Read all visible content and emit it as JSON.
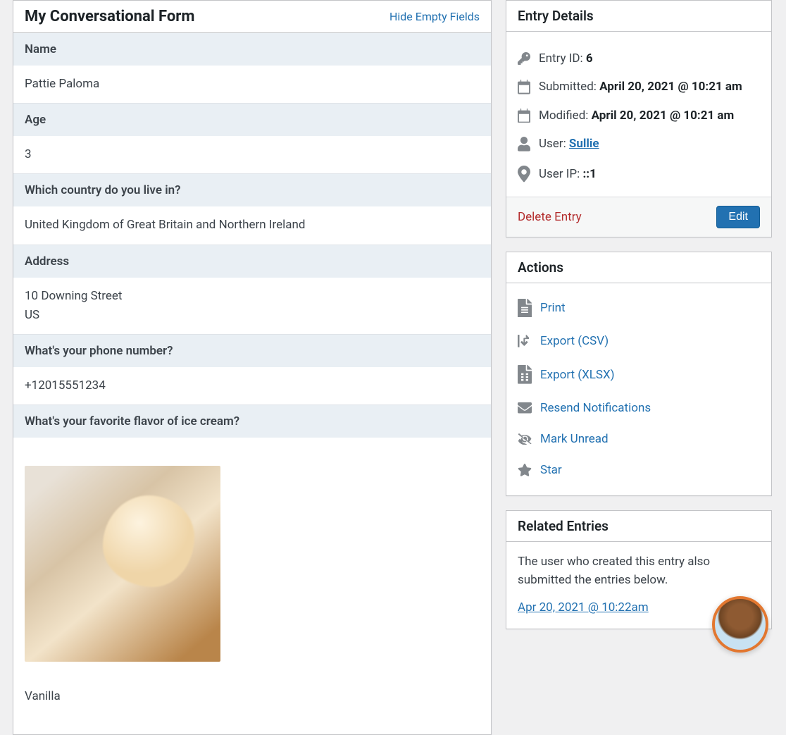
{
  "main": {
    "form_title": "My Conversational Form",
    "hide_empty_label": "Hide Empty Fields",
    "fields": [
      {
        "label": "Name",
        "value": "Pattie Paloma"
      },
      {
        "label": "Age",
        "value": "3"
      },
      {
        "label": "Which country do you live in?",
        "value": "United Kingdom of Great Britain and Northern Ireland"
      },
      {
        "label": "Address",
        "value": "10 Downing Street\nUS"
      },
      {
        "label": "What's your phone number?",
        "value": "+12015551234"
      },
      {
        "label": "What's your favorite flavor of ice cream?",
        "value": "Vanilla",
        "has_image": true
      }
    ]
  },
  "sidebar": {
    "details": {
      "title": "Entry Details",
      "entry_id_label": "Entry ID:",
      "entry_id_value": "6",
      "submitted_label": "Submitted:",
      "submitted_value": "April 20, 2021 @ 10:21 am",
      "modified_label": "Modified:",
      "modified_value": "April 20, 2021 @ 10:21 am",
      "user_label": "User:",
      "user_value": "Sullie",
      "ip_label": "User IP:",
      "ip_value": "::1",
      "delete_label": "Delete Entry",
      "edit_label": "Edit"
    },
    "actions": {
      "title": "Actions",
      "items": [
        {
          "label": "Print",
          "icon": "document-icon"
        },
        {
          "label": "Export (CSV)",
          "icon": "export-icon"
        },
        {
          "label": "Export (XLSX)",
          "icon": "spreadsheet-icon"
        },
        {
          "label": "Resend Notifications",
          "icon": "mail-icon"
        },
        {
          "label": "Mark Unread",
          "icon": "eye-slash-icon"
        },
        {
          "label": "Star",
          "icon": "star-icon"
        }
      ]
    },
    "related": {
      "title": "Related Entries",
      "intro": "The user who created this entry also submitted the entries below.",
      "links": [
        {
          "label": "Apr 20, 2021 @ 10:22am"
        }
      ]
    }
  }
}
